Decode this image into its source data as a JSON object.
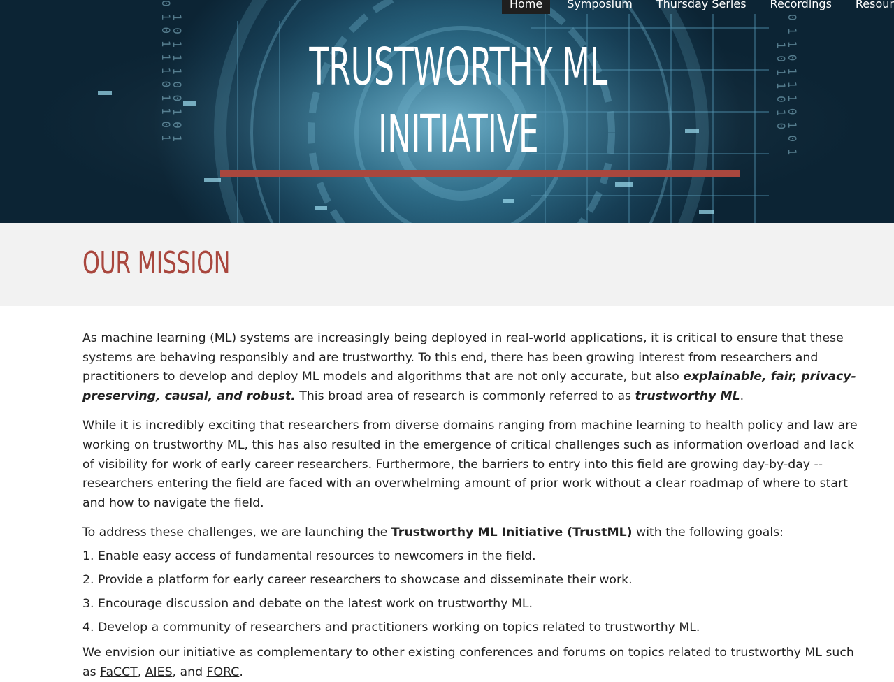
{
  "nav": {
    "items": [
      "Home",
      "Symposium",
      "Thursday Series",
      "Recordings",
      "Resour"
    ],
    "active": "Home"
  },
  "hero": {
    "title_line1": "TRUSTWORTHY ML",
    "title_line2": "INITIATIVE",
    "accent_color": "#a9473e"
  },
  "mission": {
    "heading": "OUR MISSION",
    "p1_a": "As machine learning (ML) systems are increasingly being deployed in real-world applications, it is critical to ensure that these systems are behaving responsibly and are trustworthy.  To this end, there has been growing interest from researchers and practitioners to develop and deploy ML models and algorithms that are not only accurate, but also ",
    "p1_em": "explainable, fair, privacy-preserving, causal, and robust.",
    "p1_b": " This broad area of research is commonly referred to as ",
    "p1_em2": "trustworthy ML",
    "p1_c": ".",
    "p2": "While it is incredibly exciting that researchers from diverse domains ranging from machine learning to health policy and law are working on trustworthy ML, this has also resulted in the emergence of critical challenges such as information overload and lack of visibility for work of early career researchers. Furthermore, the barriers to entry into this field are growing day-by-day -- researchers entering the field are faced with an overwhelming amount of prior work without a clear roadmap of where to start and how to navigate the field.",
    "p3_a": "To address these challenges, we are launching the ",
    "p3_b": "Trustworthy ML Initiative (TrustML)",
    "p3_c": " with the following goals:",
    "goals": [
      "1. Enable easy access of fundamental resources to newcomers in the field.",
      "2. Provide a platform for early career researchers to showcase and disseminate their work.",
      "3. Encourage discussion and debate on the latest work on trustworthy ML.",
      "4. Develop a community of researchers and practitioners working on topics related to trustworthy ML."
    ],
    "p4_a": "We envision our initiative as complementary to other existing conferences and forums on topics related to trustworthy ML such as ",
    "link_facct": "FaCCT",
    "p4_sep1": ",",
    "link_aies": "AIES",
    "p4_sep2": ", and ",
    "link_forc": "FORC",
    "p4_end": "."
  }
}
